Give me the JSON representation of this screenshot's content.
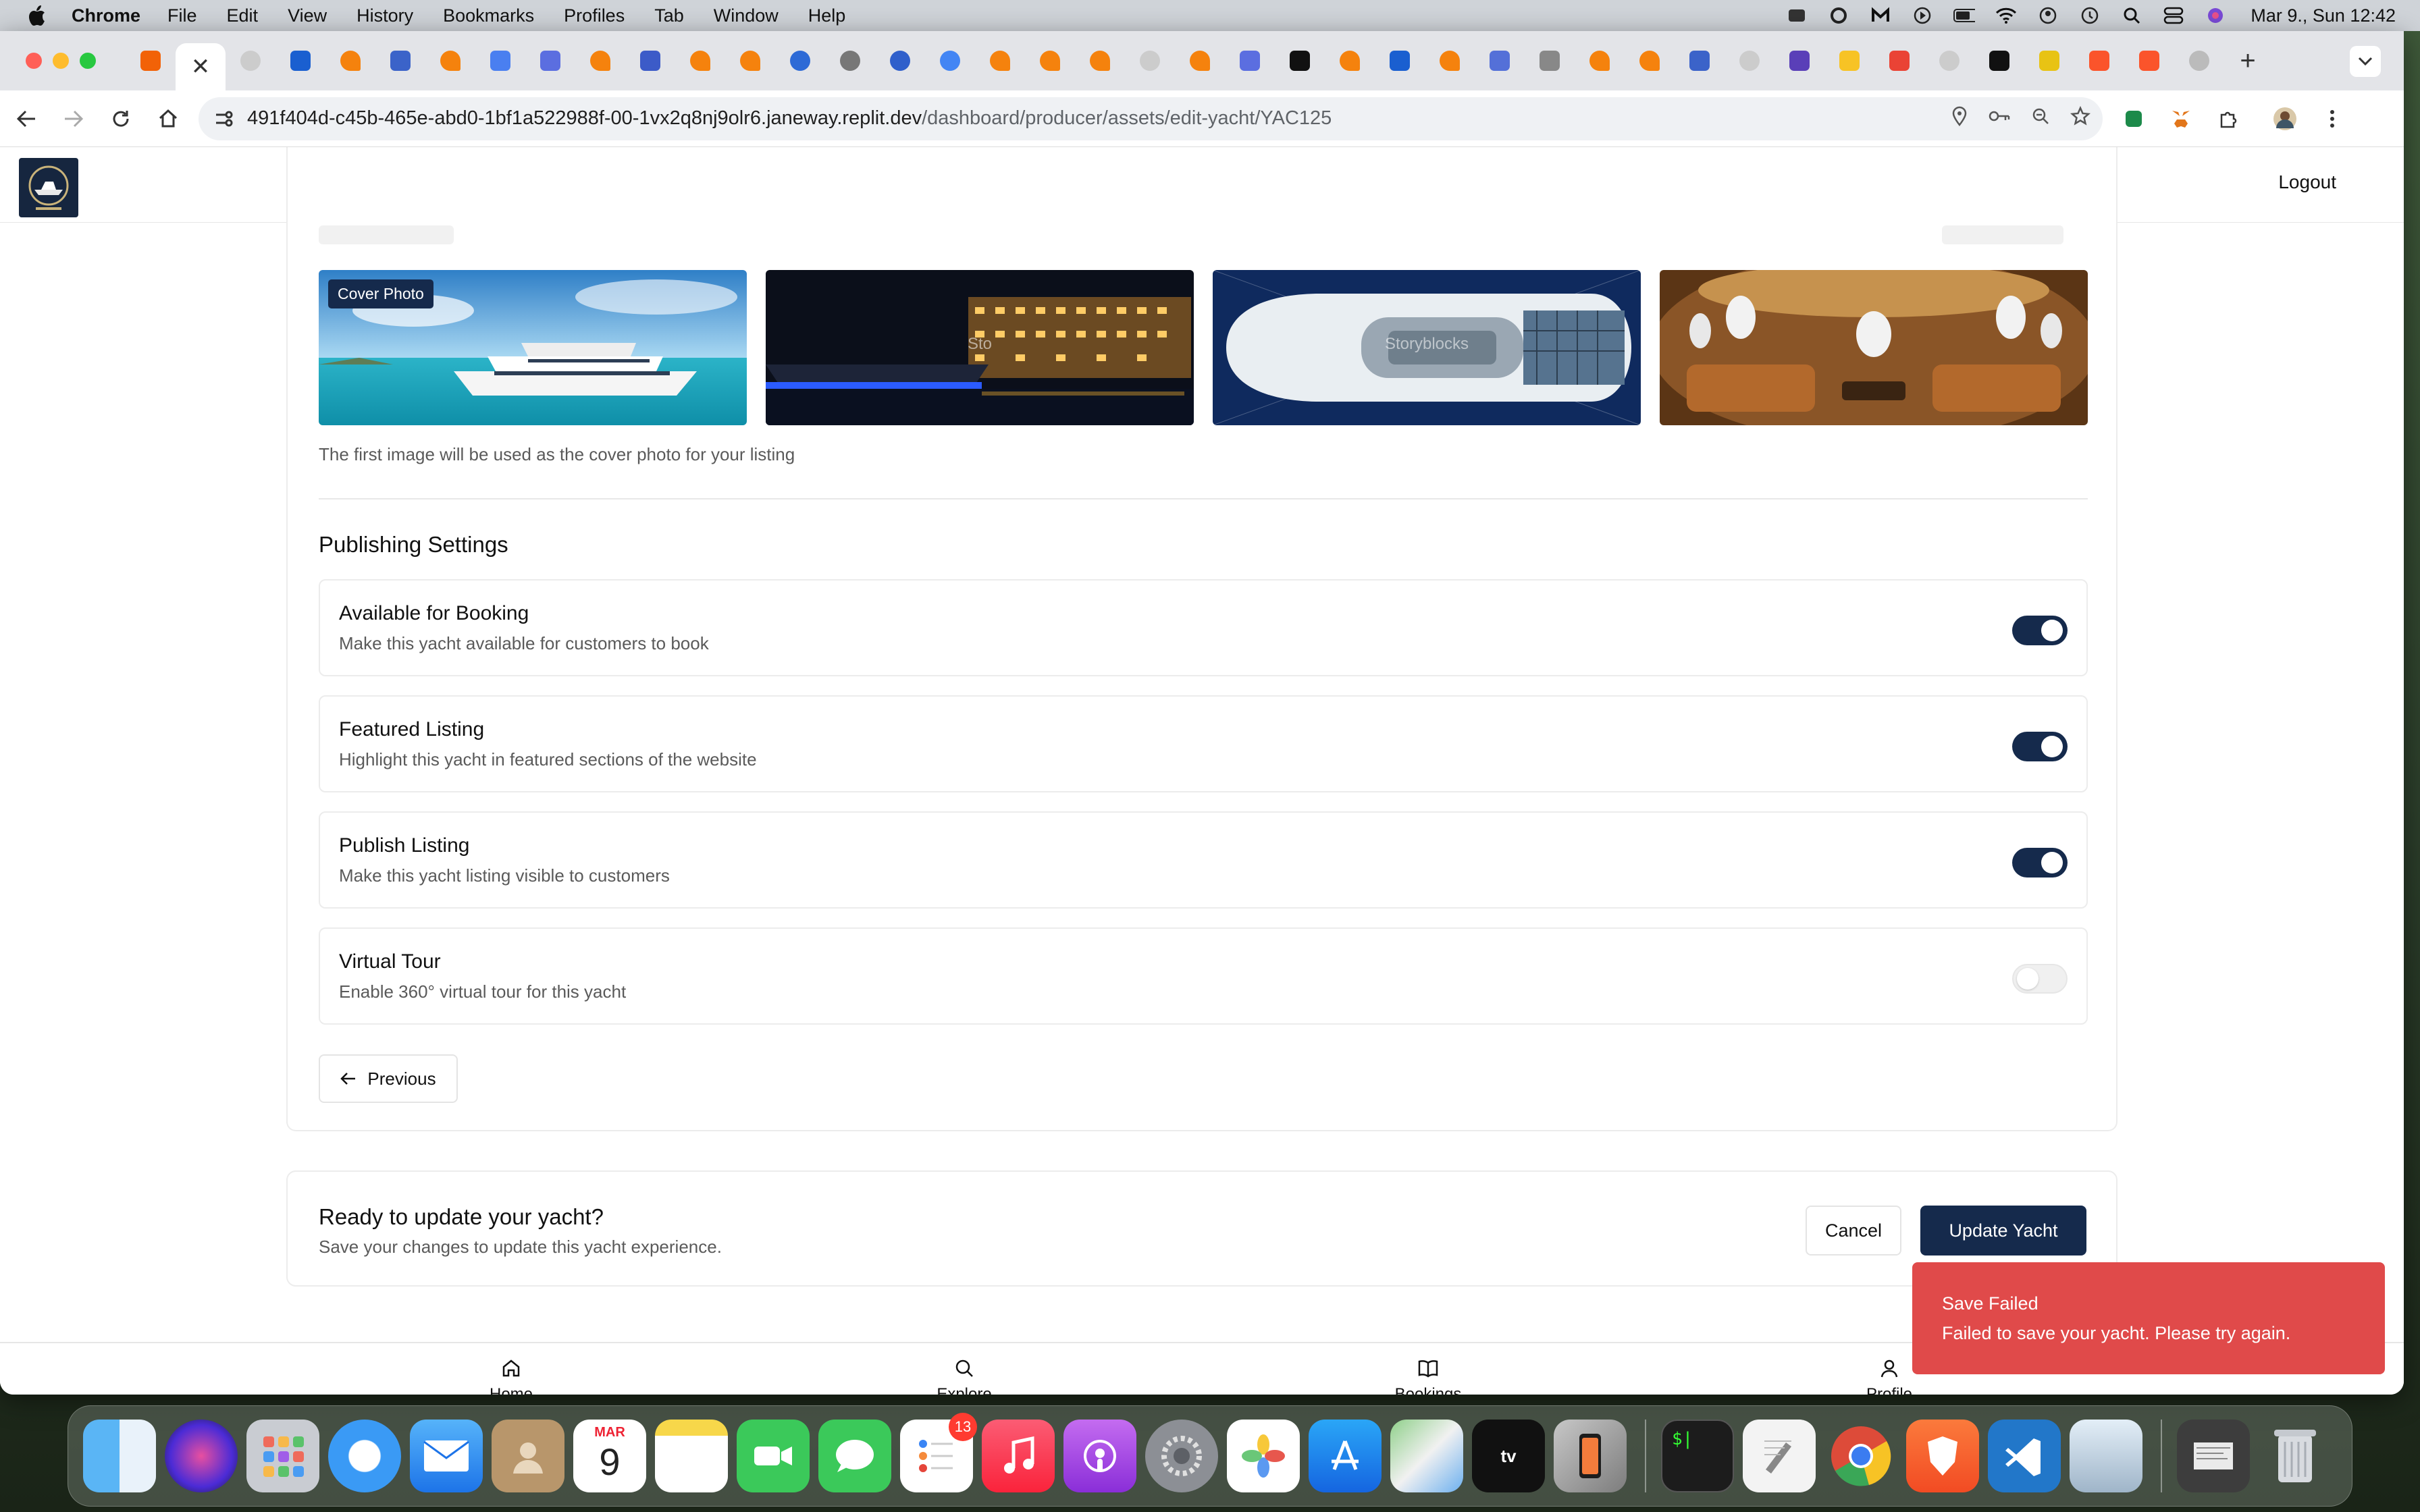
{
  "menubar": {
    "app_name": "Chrome",
    "menus": [
      "File",
      "Edit",
      "View",
      "History",
      "Bookmarks",
      "Profiles",
      "Tab",
      "Window",
      "Help"
    ],
    "clock": "Mar 9., Sun  12:42"
  },
  "browser": {
    "url_host": "491f404d-c45b-465e-abd0-1bf1a522988f-00-1vx2q8nj9olr6.janeway.replit.dev",
    "url_path": "/dashboard/producer/assets/edit-yacht/YAC125",
    "close_tab_glyph": "✕",
    "new_tab_glyph": "+"
  },
  "header": {
    "logout_label": "Logout"
  },
  "photos": {
    "cover_badge": "Cover Photo",
    "watermark_1": "Sto",
    "watermark_2": "Storyblocks",
    "help_text": "The first image will be used as the cover photo for your listing"
  },
  "publishing": {
    "title": "Publishing Settings",
    "settings": [
      {
        "title": "Available for Booking",
        "desc": "Make this yacht available for customers to book",
        "enabled": true
      },
      {
        "title": "Featured Listing",
        "desc": "Highlight this yacht in featured sections of the website",
        "enabled": true
      },
      {
        "title": "Publish Listing",
        "desc": "Make this yacht listing visible to customers",
        "enabled": true
      },
      {
        "title": "Virtual Tour",
        "desc": "Enable 360° virtual tour for this yacht",
        "enabled": false
      }
    ],
    "previous_label": "Previous"
  },
  "cta": {
    "title": "Ready to update your yacht?",
    "desc": "Save your changes to update this yacht experience.",
    "cancel_label": "Cancel",
    "update_label": "Update Yacht"
  },
  "bottom_nav": {
    "items": [
      {
        "label": "Home",
        "icon": "home-icon"
      },
      {
        "label": "Explore",
        "icon": "search-icon"
      },
      {
        "label": "Bookings",
        "icon": "book-icon"
      },
      {
        "label": "Profile",
        "icon": "user-icon"
      }
    ]
  },
  "toast": {
    "title": "Save Failed",
    "message": "Failed to save your yacht. Please try again."
  },
  "dock": {
    "calendar_month": "MAR",
    "calendar_day": "9",
    "reminders_badge": "13",
    "tv_label": "tv",
    "terminal_label": "$|"
  },
  "colors": {
    "accent": "#152a4c",
    "toast": "#e04a4a"
  }
}
